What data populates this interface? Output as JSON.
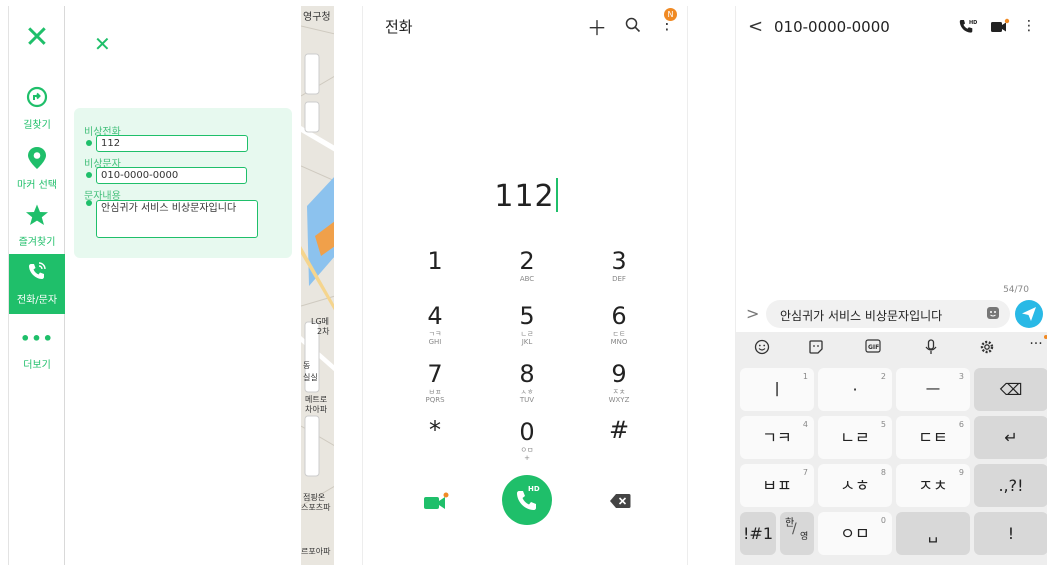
{
  "map_app": {
    "sidebar": {
      "close_icon": "close-icon",
      "items": [
        {
          "label": "길찾기",
          "icon": "directions-icon"
        },
        {
          "label": "마커 선택",
          "icon": "marker-icon"
        },
        {
          "label": "즐겨찾기",
          "icon": "star-icon"
        },
        {
          "label": "전화/문자",
          "icon": "phone-icon",
          "active": true
        },
        {
          "label": "더보기",
          "icon": "more-icon"
        }
      ]
    },
    "panel": {
      "fields": [
        {
          "label": "비상전화",
          "value": "112"
        },
        {
          "label": "비상문자",
          "value": "010-0000-0000"
        },
        {
          "label": "문자내용",
          "value": "안심귀가 서비스 비상문자입니다"
        }
      ]
    },
    "map_labels": [
      "영구청",
      "LG메",
      "2차",
      "동",
      "실실",
      "메트로",
      "차아파",
      "점핑온",
      "스포츠파",
      "르포아파"
    ],
    "accent_color": "#1fbf6a"
  },
  "dialer": {
    "title": "전화",
    "add_icon": "plus-icon",
    "search_icon": "search-icon",
    "menu_badge": "N",
    "number": "112",
    "keys": [
      {
        "digit": "1",
        "letters": ""
      },
      {
        "digit": "2",
        "letters": "ABC"
      },
      {
        "digit": "3",
        "letters": "DEF"
      },
      {
        "digit": "4",
        "letters": "ㄱㅋ\nGHI"
      },
      {
        "digit": "5",
        "letters": "ㄴㄹ\nJKL"
      },
      {
        "digit": "6",
        "letters": "ㄷㅌ\nMNO"
      },
      {
        "digit": "7",
        "letters": "ㅂㅍ\nPQRS"
      },
      {
        "digit": "8",
        "letters": "ㅅㅎ\nTUV"
      },
      {
        "digit": "9",
        "letters": "ㅈㅊ\nWXYZ"
      },
      {
        "digit": "*",
        "letters": ""
      },
      {
        "digit": "0",
        "letters": "ㅇㅁ\n+"
      },
      {
        "digit": "#",
        "letters": ""
      }
    ],
    "call_badge": "HD"
  },
  "sms": {
    "recipient": "010-0000-0000",
    "call_badge": "HD",
    "char_counter": "54/70",
    "message": "안심귀가 서비스 비상문자입니다",
    "keyboard": {
      "rows": [
        [
          {
            "main": "ㅣ",
            "sup": "1"
          },
          {
            "main": "·",
            "sup": "2"
          },
          {
            "main": "ㅡ",
            "sup": "3"
          },
          {
            "main": "⌫",
            "sup": ""
          }
        ],
        [
          {
            "main": "ㄱㅋ",
            "sup": "4"
          },
          {
            "main": "ㄴㄹ",
            "sup": "5"
          },
          {
            "main": "ㄷㅌ",
            "sup": "6"
          },
          {
            "main": "↵",
            "sup": ""
          }
        ],
        [
          {
            "main": "ㅂㅍ",
            "sup": "7"
          },
          {
            "main": "ㅅㅎ",
            "sup": "8"
          },
          {
            "main": "ㅈㅊ",
            "sup": "9"
          },
          {
            "main": ".,?!",
            "sup": ""
          }
        ],
        [
          {
            "main": "!#1",
            "sup": ""
          },
          {
            "main": "한/영",
            "sup": ""
          },
          {
            "main": "ㅇㅁ",
            "sup": "0"
          },
          {
            "main": "␣",
            "sup": ""
          },
          {
            "main": "!",
            "sup": ""
          }
        ]
      ],
      "lang_top": "한",
      "lang_bottom": "영"
    }
  }
}
